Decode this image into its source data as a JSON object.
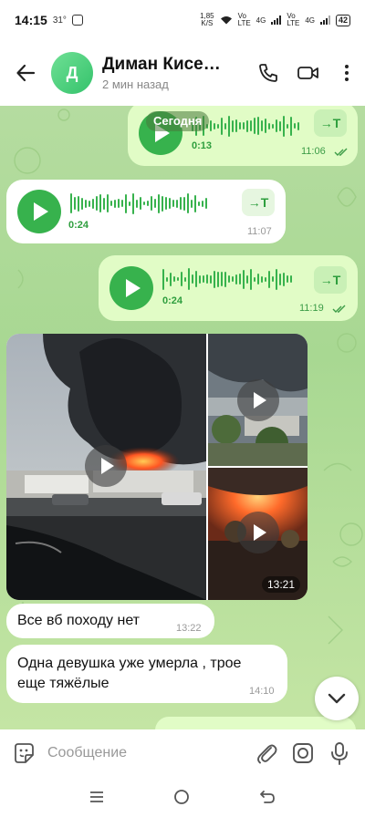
{
  "status_bar": {
    "time": "14:15",
    "temp": "31°",
    "net_speed": "1,85",
    "net_unit": "K/S",
    "net1": "Vo LTE",
    "net1_tag": "4G",
    "net2": "Vo LTE",
    "net2_tag": "4G",
    "battery": "42"
  },
  "header": {
    "avatar_letter": "Д",
    "contact_name": "Диман Кисе…",
    "last_seen": "2 мин назад"
  },
  "chat": {
    "date_label": "Сегодня",
    "messages": [
      {
        "type": "voice",
        "direction": "out",
        "duration": "0:13",
        "time": "11:06",
        "transcribe": "→T"
      },
      {
        "type": "voice",
        "direction": "in",
        "duration": "0:24",
        "time": "11:07",
        "transcribe": "→T"
      },
      {
        "type": "voice",
        "direction": "out",
        "duration": "0:24",
        "time": "11:19",
        "transcribe": "→T"
      },
      {
        "type": "album",
        "direction": "in",
        "time": "13:21"
      },
      {
        "type": "text",
        "direction": "in",
        "text": "Все вб походу нет",
        "time": "13:22"
      },
      {
        "type": "text",
        "direction": "in",
        "text_line1": "Одна девушка уже умерла , трое",
        "text_line2": "еще тяжёлые",
        "time": "14:10"
      }
    ]
  },
  "input": {
    "placeholder": "Сообщение"
  },
  "colors": {
    "accent": "#37b24d",
    "outgoing_bubble": "#e1fcc6",
    "incoming_bubble": "#ffffff",
    "chat_background": "#a8d892"
  }
}
